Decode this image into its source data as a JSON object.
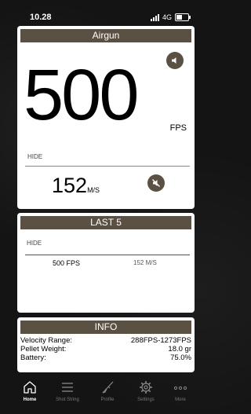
{
  "status_bar": {
    "time": "10.28",
    "network": "4G",
    "battery_level": 0.6
  },
  "airgun": {
    "title": "Airgun",
    "velocity_fps": "500",
    "fps_unit": "FPS",
    "hide_label": "HIDE",
    "velocity_ms": "152",
    "ms_unit": "M/S"
  },
  "last5": {
    "title": "LAST 5",
    "hide_label": "HIDE",
    "shots": [
      {
        "fps": "500 FPS",
        "ms": "152 M/S"
      }
    ]
  },
  "info": {
    "title": "INFO",
    "rows": [
      {
        "label": "Velocity Range:",
        "value": "288FPS-1273FPS"
      },
      {
        "label": "Pellet Weight:",
        "value": "18.0 gr"
      },
      {
        "label": "Battery:",
        "value": "75.0%"
      }
    ]
  },
  "tabs": [
    {
      "label": "Home",
      "icon": "home-icon",
      "active": true
    },
    {
      "label": "Shot String",
      "icon": "list-icon",
      "active": false
    },
    {
      "label": "Profile",
      "icon": "rifle-icon",
      "active": false
    },
    {
      "label": "Settings",
      "icon": "gear-icon",
      "active": false
    },
    {
      "label": "More",
      "icon": "more-icon",
      "active": false
    }
  ]
}
